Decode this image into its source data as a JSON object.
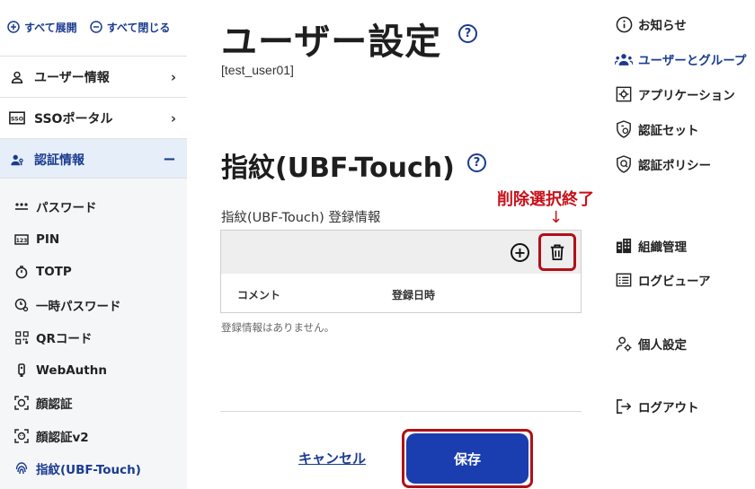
{
  "sidebar": {
    "expand_all": "すべて展開",
    "collapse_all": "すべて閉じる",
    "items": [
      {
        "label": "ユーザー情報",
        "chevron": "›"
      },
      {
        "label": "SSOポータル",
        "chevron": "›"
      },
      {
        "label": "認証情報",
        "chevron": "−"
      }
    ],
    "sub_items": [
      {
        "label": "パスワード",
        "icon": "password-dots-icon"
      },
      {
        "label": "PIN",
        "icon": "pin-keypad-icon"
      },
      {
        "label": "TOTP",
        "icon": "stopwatch-icon"
      },
      {
        "label": "一時パスワード",
        "icon": "temp-key-icon"
      },
      {
        "label": "QRコード",
        "icon": "qr-code-icon"
      },
      {
        "label": "WebAuthn",
        "icon": "security-key-icon"
      },
      {
        "label": "顔認証",
        "icon": "face-scan-icon"
      },
      {
        "label": "顔認証v2",
        "icon": "face-scan-v2-icon"
      },
      {
        "label": "指紋(UBF-Touch)",
        "icon": "fingerprint-icon"
      }
    ]
  },
  "main": {
    "page_title": "ユーザー設定",
    "user_id": "[test_user01]",
    "section_title": "指紋(UBF-Touch)",
    "registration_label": "指紋(UBF-Touch) 登録情報",
    "table": {
      "columns": [
        "コメント",
        "登録日時"
      ],
      "rows": []
    },
    "no_data": "登録情報はありません。",
    "cancel_label": "キャンセル",
    "save_label": "保存",
    "help_glyph": "?",
    "add_glyph": "+"
  },
  "annotation": {
    "label": "削除選択終了",
    "arrow": "↓",
    "color": "#c8111a"
  },
  "right_nav": {
    "items": [
      {
        "label": "お知らせ",
        "icon": "info-icon"
      },
      {
        "label": "ユーザーとグループ",
        "icon": "users-group-icon"
      },
      {
        "label": "アプリケーション",
        "icon": "app-gear-icon"
      },
      {
        "label": "認証セット",
        "icon": "auth-set-icon"
      },
      {
        "label": "認証ポリシー",
        "icon": "auth-policy-icon"
      },
      {
        "label": "組織管理",
        "icon": "organization-icon"
      },
      {
        "label": "ログビューア",
        "icon": "log-viewer-icon"
      },
      {
        "label": "個人設定",
        "icon": "personal-settings-icon"
      },
      {
        "label": "ログアウト",
        "icon": "logout-icon"
      }
    ]
  },
  "colors": {
    "accent": "#1a3b8f",
    "primary_button": "#1a3db0",
    "highlight_frame": "#b01018"
  }
}
